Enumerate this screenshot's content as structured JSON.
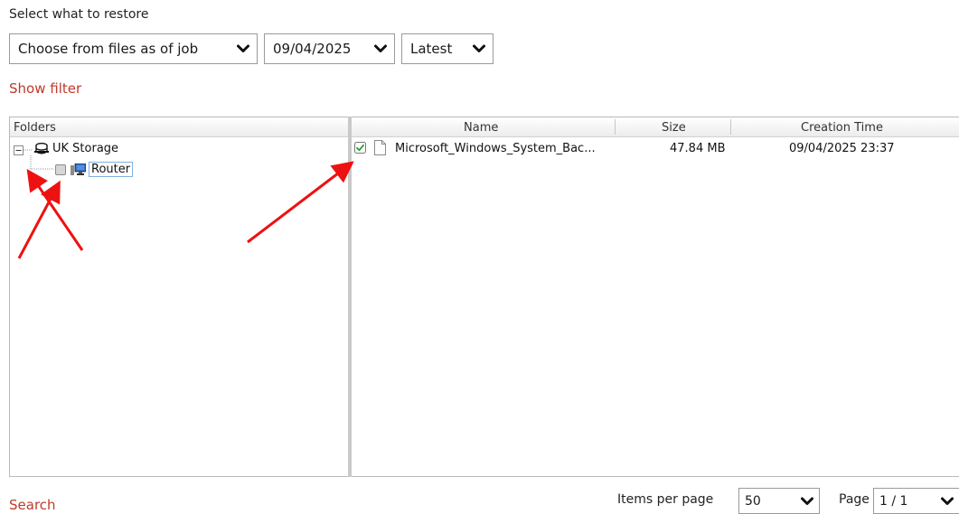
{
  "title": "Select what to restore",
  "selectors": {
    "source": "Choose from files as of job",
    "date": "09/04/2025",
    "version": "Latest"
  },
  "show_filter": "Show filter",
  "folders": {
    "header": "Folders",
    "root": "UK Storage",
    "child": "Router"
  },
  "files": {
    "headers": {
      "name": "Name",
      "size": "Size",
      "created": "Creation Time"
    },
    "rows": [
      {
        "name": "Microsoft_Windows_System_Bac...",
        "size": "47.84 MB",
        "created": "09/04/2025 23:37",
        "checked": true
      }
    ]
  },
  "search": "Search",
  "pagination": {
    "items_label": "Items per page",
    "items_value": "50",
    "page_label": "Page",
    "page_value": "1 / 1"
  },
  "colors": {
    "link": "#c0392b",
    "annotation_arrow": "#ee1111",
    "check": "#2e9e2e"
  }
}
